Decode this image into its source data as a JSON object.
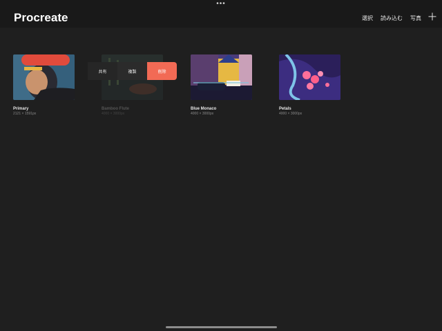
{
  "header": {
    "title": "Procreate",
    "more": "•••",
    "nav": {
      "select": "選択",
      "import": "読み込む",
      "photo": "写真"
    },
    "add_icon": "plus-icon"
  },
  "gallery": {
    "items": [
      {
        "title": "Primary",
        "dims": "2121 × 1591px"
      },
      {
        "title": "Bamboo Flute",
        "dims": "4000 × 3000px"
      },
      {
        "title": "Blue Monaco",
        "dims": "4000 × 3000px"
      },
      {
        "title": "Petals",
        "dims": "4000 × 3000px"
      }
    ]
  },
  "swipe_actions": {
    "share": "共有",
    "duplicate": "複製",
    "delete": "削除",
    "delete_color": "#f26a55"
  }
}
